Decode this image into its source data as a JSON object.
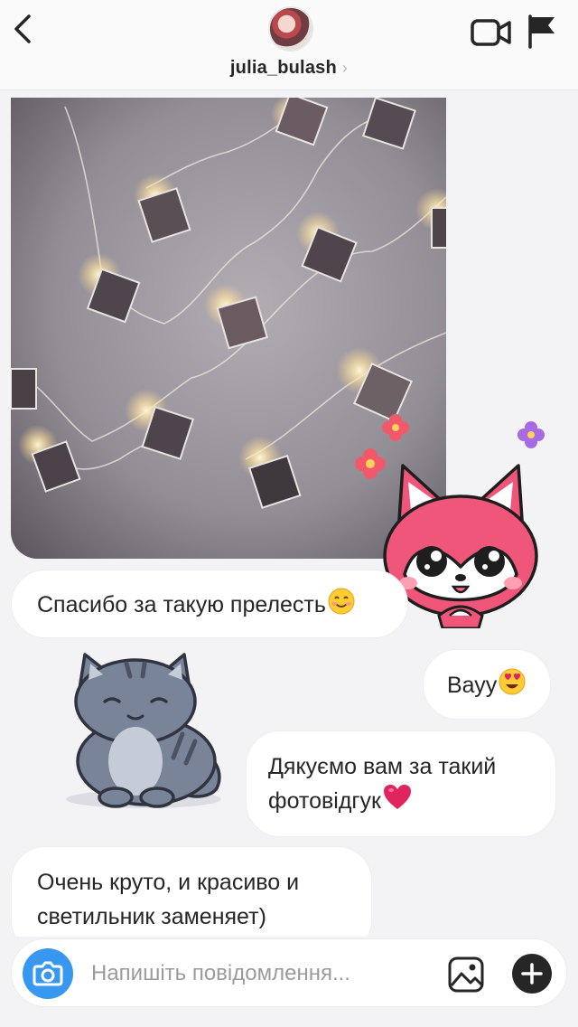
{
  "header": {
    "username": "julia_bulash",
    "chevron": "›",
    "icons": {
      "back": "chevron-left-icon",
      "video": "video-camera-icon",
      "flag": "flag-icon"
    }
  },
  "messages": [
    {
      "side": "left",
      "text": "Спасибо за такую прелесть",
      "emoji": "smiling-face-emoji"
    },
    {
      "side": "right",
      "text": "Вауу",
      "emoji": "heart-eyes-emoji"
    },
    {
      "side": "right",
      "line1": "Дякуємо вам за такий",
      "line2": "фотовідгук",
      "emoji": "red-heart-emoji"
    },
    {
      "side": "left",
      "line1": "Очень круто, и красиво и",
      "line2": "светильник заменяет)"
    }
  ],
  "stickers": [
    "pink-fox-sticker",
    "gray-cat-sticker"
  ],
  "composer": {
    "placeholder": "Напишіть повідомлення...",
    "value": ""
  },
  "colors": {
    "accent": "#3897f0",
    "heart": "#e0245e",
    "fox_pink": "#f0567a"
  }
}
